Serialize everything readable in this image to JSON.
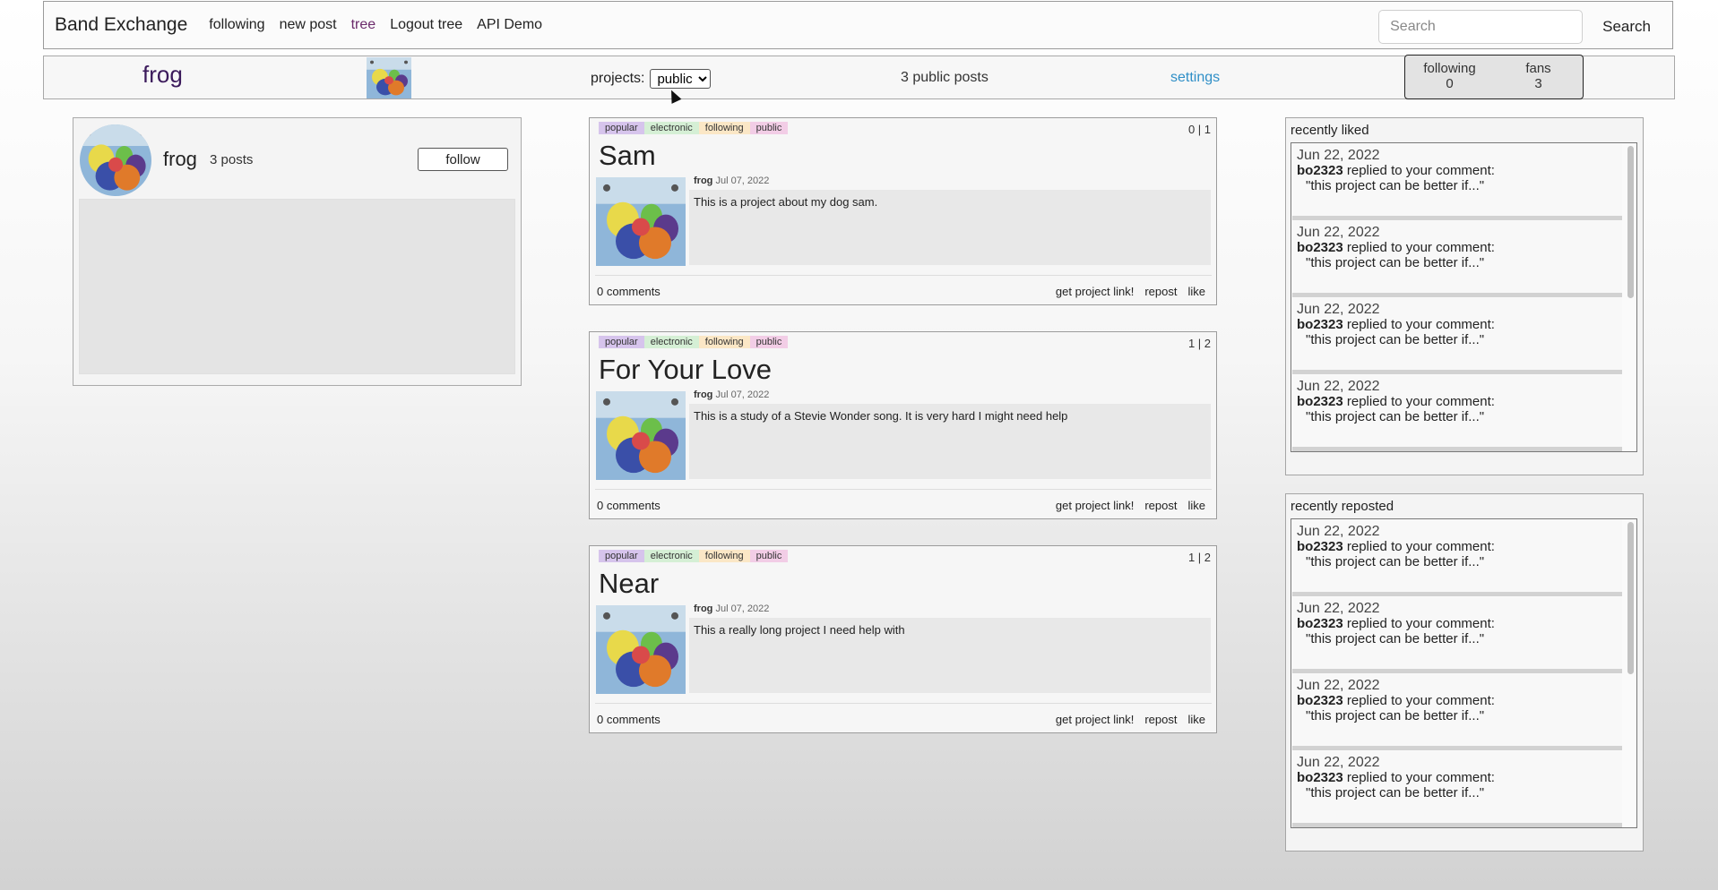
{
  "nav": {
    "brand": "Band Exchange",
    "links": [
      "following",
      "new post",
      "tree",
      "Logout tree",
      "API Demo"
    ],
    "search_placeholder": "Search",
    "search_button": "Search"
  },
  "profile_bar": {
    "name": "frog",
    "projects_label": "projects:",
    "projects_selected": "public",
    "public_posts": "3 public posts",
    "settings": "settings",
    "following_label": "following",
    "following_count": "0",
    "fans_label": "fans",
    "fans_count": "3"
  },
  "profile_card": {
    "name": "frog",
    "posts": "3 posts",
    "follow_button": "follow"
  },
  "posts": [
    {
      "tags": [
        "popular",
        "electronic",
        "following",
        "public"
      ],
      "votes": "0 | 1",
      "title": "Sam",
      "author": "frog",
      "date": "Jul 07, 2022",
      "body": "This is a project about my dog sam.",
      "comments": "0 comments",
      "actions": [
        "get project link!",
        "repost",
        "like"
      ]
    },
    {
      "tags": [
        "popular",
        "electronic",
        "following",
        "public"
      ],
      "votes": "1 | 2",
      "title": "For Your Love",
      "author": "frog",
      "date": "Jul 07, 2022",
      "body": "This is a study of a Stevie Wonder song. It is very hard I might need help",
      "comments": "0 comments",
      "actions": [
        "get project link!",
        "repost",
        "like"
      ]
    },
    {
      "tags": [
        "popular",
        "electronic",
        "following",
        "public"
      ],
      "votes": "1 | 2",
      "title": "Near",
      "author": "frog",
      "date": "Jul 07, 2022",
      "body": "This a really long project I need help with",
      "comments": "0 comments",
      "actions": [
        "get project link!",
        "repost",
        "like"
      ]
    }
  ],
  "recently_liked": {
    "title": "recently liked",
    "items": [
      {
        "date": "Jun 22, 2022",
        "user": "bo2323",
        "text": "replied to your comment:",
        "quote": "\"this project can be better if...\""
      },
      {
        "date": "Jun 22, 2022",
        "user": "bo2323",
        "text": "replied to your comment:",
        "quote": "\"this project can be better if...\""
      },
      {
        "date": "Jun 22, 2022",
        "user": "bo2323",
        "text": "replied to your comment:",
        "quote": "\"this project can be better if...\""
      },
      {
        "date": "Jun 22, 2022",
        "user": "bo2323",
        "text": "replied to your comment:",
        "quote": "\"this project can be better if...\""
      }
    ]
  },
  "recently_reposted": {
    "title": "recently reposted",
    "items": [
      {
        "date": "Jun 22, 2022",
        "user": "bo2323",
        "text": "replied to your comment:",
        "quote": "\"this project can be better if...\""
      },
      {
        "date": "Jun 22, 2022",
        "user": "bo2323",
        "text": "replied to your comment:",
        "quote": "\"this project can be better if...\""
      },
      {
        "date": "Jun 22, 2022",
        "user": "bo2323",
        "text": "replied to your comment:",
        "quote": "\"this project can be better if...\""
      },
      {
        "date": "Jun 22, 2022",
        "user": "bo2323",
        "text": "replied to your comment:",
        "quote": "\"this project can be better if...\""
      }
    ]
  },
  "colors": {
    "accent_purple": "#3b1a5b",
    "settings_link": "#2f8fc7",
    "tag_popular": "#d6c4ec",
    "tag_electronic": "#d5efd5",
    "tag_following": "#fbe7c6",
    "tag_public": "#f2cde6"
  }
}
